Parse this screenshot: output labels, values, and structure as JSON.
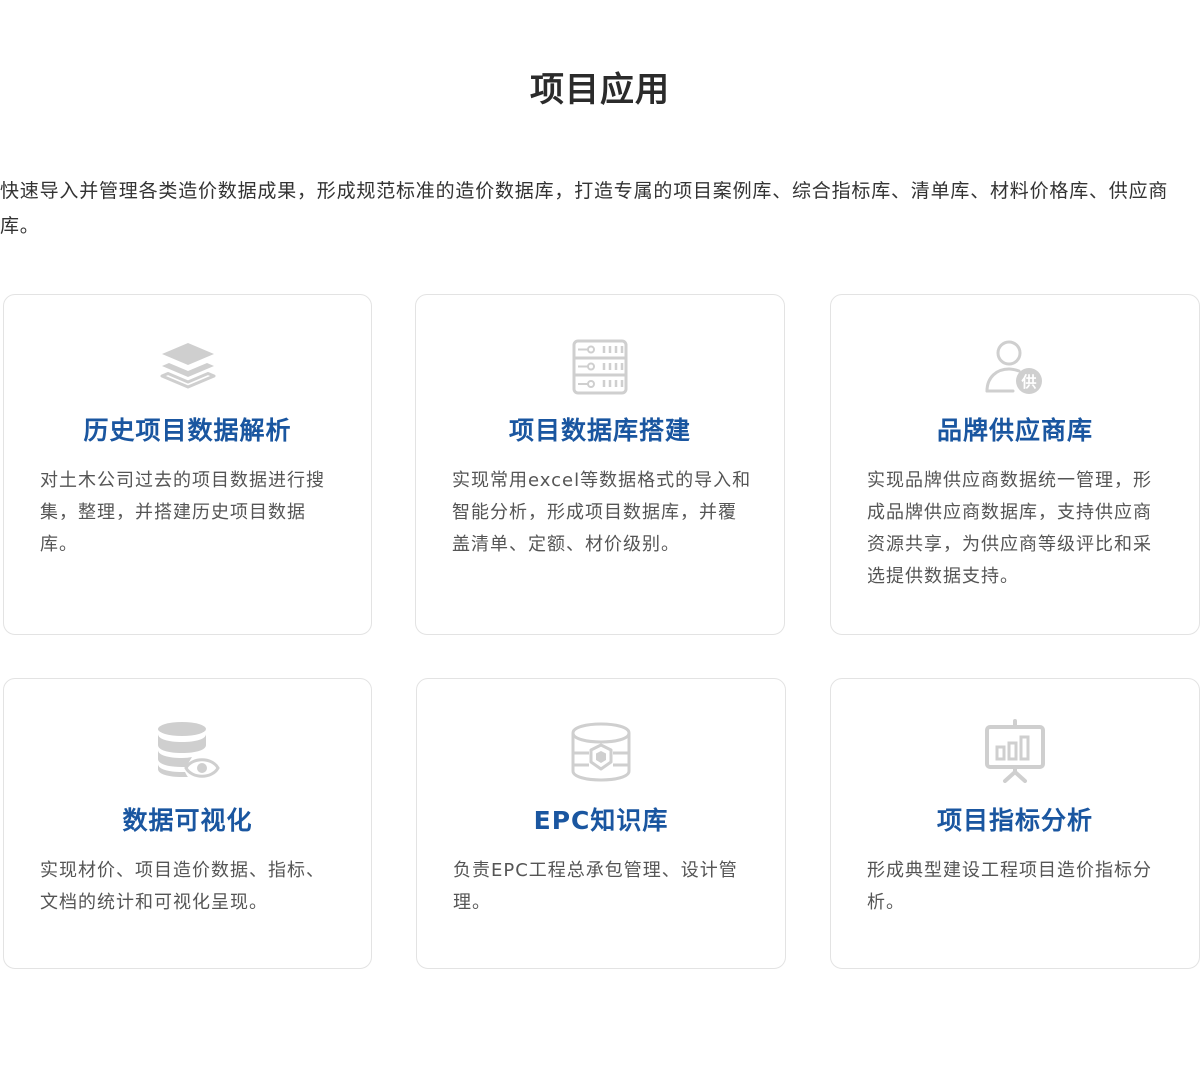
{
  "page": {
    "title": "项目应用",
    "intro": "快速导入并管理各类造价数据成果，形成规范标准的造价数据库，打造专属的项目案例库、综合指标库、清单库、材料价格库、供应商库。"
  },
  "colors": {
    "title_blue": "#1a56a0",
    "icon_gray": "#cfcfcf",
    "border": "#e3e3e3"
  },
  "cards": [
    {
      "icon": "layers-icon",
      "title": "历史项目数据解析",
      "desc": "对土木公司过去的项目数据进行搜集，整理，并搭建历史项目数据库。"
    },
    {
      "icon": "server-rack-icon",
      "title": "项目数据库搭建",
      "desc": "实现常用excel等数据格式的导入和智能分析，形成项目数据库，并覆盖清单、定额、材价级别。"
    },
    {
      "icon": "supplier-user-icon",
      "icon_text": "供",
      "title": "品牌供应商库",
      "desc": "实现品牌供应商数据统一管理，形成品牌供应商数据库，支持供应商资源共享，为供应商等级评比和采选提供数据支持。"
    },
    {
      "icon": "database-eye-icon",
      "title": "数据可视化",
      "desc": "实现材价、项目造价数据、指标、文档的统计和可视化呈现。"
    },
    {
      "icon": "database-shield-icon",
      "title": "EPC知识库",
      "desc": "负责EPC工程总承包管理、设计管理。"
    },
    {
      "icon": "presentation-chart-icon",
      "title": "项目指标分析",
      "desc": "形成典型建设工程项目造价指标分析。"
    }
  ]
}
